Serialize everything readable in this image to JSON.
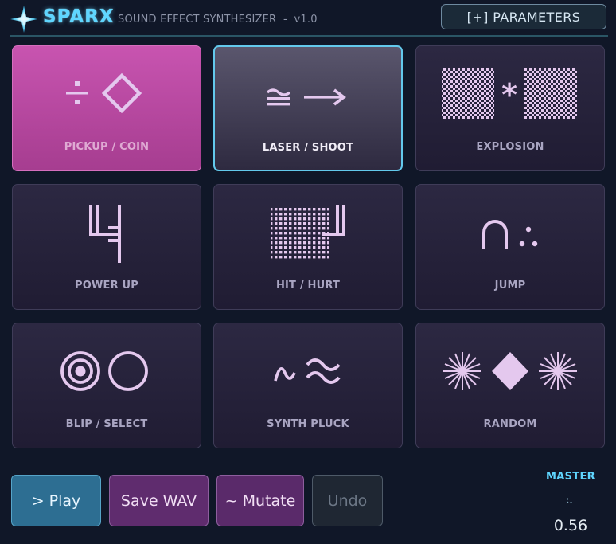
{
  "header": {
    "brand": "SPARX",
    "subtitle": "SOUND EFFECT SYNTHESIZER  -  v1.0",
    "parameters_button": "[+] PARAMETERS",
    "logo_icon": "sparkle-star-icon"
  },
  "colors": {
    "background": "#101728",
    "accent": "#5fd6ff",
    "tile": "#2a2640",
    "tile_pink": "#bd4ca6",
    "tile_active_border": "#63c9ec",
    "glyph": "#e4c8ee"
  },
  "presets": [
    {
      "label": "PICKUP / COIN",
      "glyph": "÷ ◇",
      "icon": "divide-diamond-icon",
      "state": "highlighted"
    },
    {
      "label": "LASER / SHOOT",
      "glyph": "≌ ⟶",
      "icon": "arrow-right-icon",
      "state": "selected"
    },
    {
      "label": "EXPLOSION",
      "glyph": "▩ * ▩",
      "icon": "checker-blocks-icon",
      "state": "normal"
    },
    {
      "label": "POWER UP",
      "glyph": "stepped bars",
      "icon": "stepped-bars-icon",
      "state": "normal"
    },
    {
      "label": "HIT / HURT",
      "glyph": "dot grid",
      "icon": "dot-grid-icon",
      "state": "normal"
    },
    {
      "label": "JUMP",
      "glyph": "∩ ∴",
      "icon": "arch-dots-icon",
      "state": "normal"
    },
    {
      "label": "BLIP / SELECT",
      "glyph": "◎ ○",
      "icon": "target-circle-icon",
      "state": "normal"
    },
    {
      "label": "SYNTH PLUCK",
      "glyph": "∿ ≈",
      "icon": "sine-wave-icon",
      "state": "normal"
    },
    {
      "label": "RANDOM",
      "glyph": "✺ ◆ ✺",
      "icon": "starburst-diamond-icon",
      "state": "normal"
    }
  ],
  "actions": {
    "play": "> Play",
    "save": "Save WAV",
    "mutate": "~ Mutate",
    "undo": "Undo",
    "undo_enabled": false
  },
  "master": {
    "label": "MASTER",
    "value": "0.56",
    "level": 0.56
  }
}
